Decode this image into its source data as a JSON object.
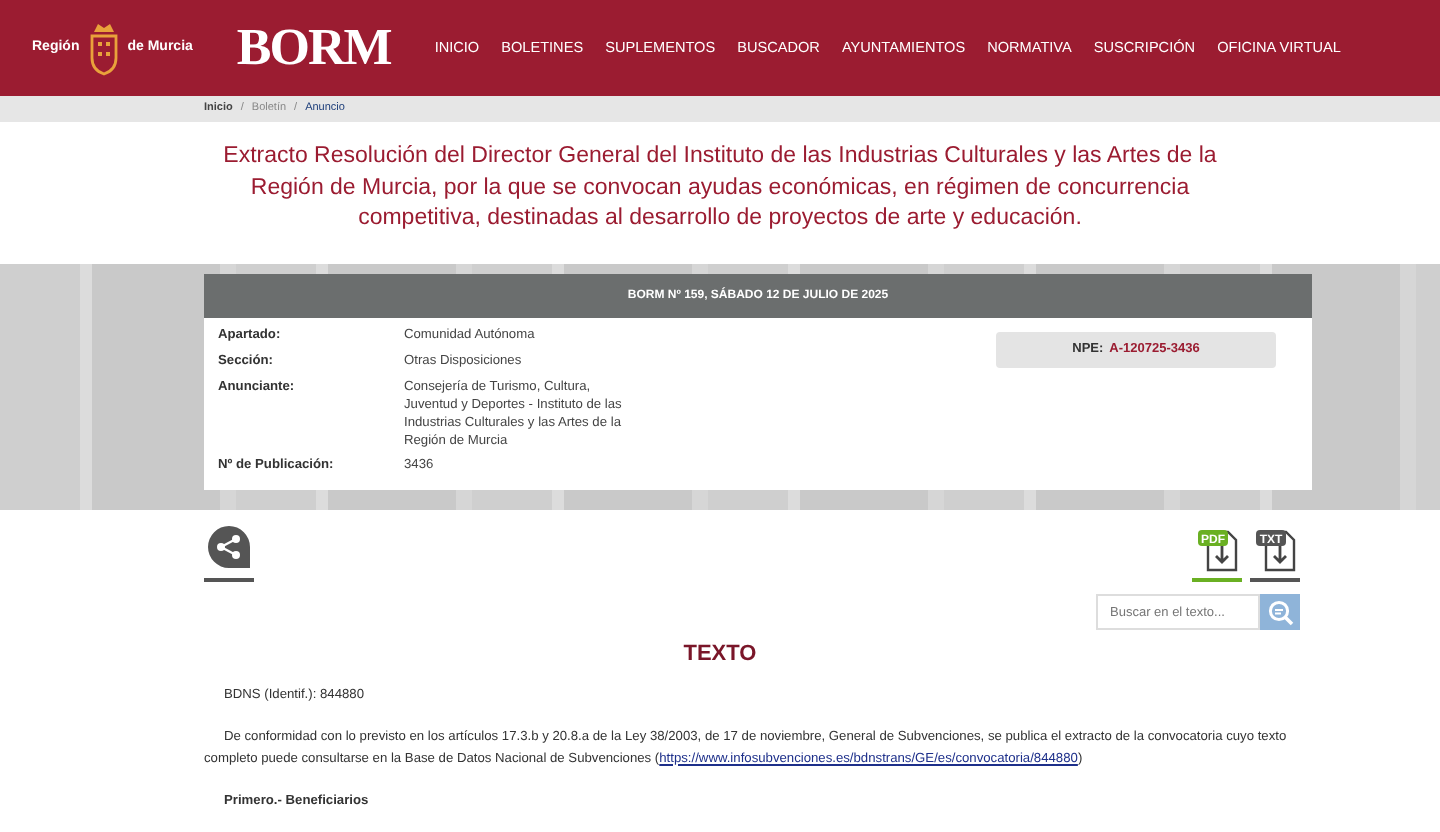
{
  "header": {
    "region_logo": {
      "left": "Región",
      "right": "de Murcia"
    },
    "site_logo": "BORM",
    "nav": [
      "INICIO",
      "BOLETINES",
      "SUPLEMENTOS",
      "BUSCADOR",
      "AYUNTAMIENTOS",
      "NORMATIVA",
      "SUSCRIPCIÓN",
      "OFICINA VIRTUAL"
    ]
  },
  "breadcrumb": [
    {
      "label": "Inicio",
      "kind": "link"
    },
    {
      "label": "Boletín",
      "kind": "muted"
    },
    {
      "label": "Anuncio",
      "kind": "current"
    }
  ],
  "breadcrumb_separator": "/",
  "title": "Extracto Resolución del Director General del Instituto de las Industrias Culturales y las Artes de la Región de Murcia, por la que se convocan ayudas económicas, en régimen de concurrencia competitiva, destinadas al desarrollo de proyectos de arte y educación.",
  "bulletin": {
    "heading": "BORM Nº 159, SÁBADO 12 DE JULIO DE 2025",
    "fields": [
      {
        "label": "Apartado:",
        "value": "Comunidad Autónoma"
      },
      {
        "label": "Sección:",
        "value": "Otras Disposiciones"
      },
      {
        "label": "Anunciante:",
        "value": "Consejería de Turismo, Cultura, Juventud y Deportes - Instituto de las Industrias Culturales y las Artes de la Región de Murcia"
      },
      {
        "label": "Nº de Publicación:",
        "value": "3436"
      }
    ],
    "npe": {
      "label": "NPE:",
      "value": "A-120725-3436"
    }
  },
  "downloads": [
    {
      "label": "PDF",
      "color": "#6ab023"
    },
    {
      "label": "TXT",
      "color": "#555555"
    }
  ],
  "search": {
    "placeholder": "Buscar en el texto..."
  },
  "text_heading": "TEXTO",
  "body": [
    {
      "kind": "plain",
      "text": "BDNS (Identif.): 844880"
    },
    {
      "kind": "link_paragraph",
      "text": "De conformidad con lo previsto en los artículos 17.3.b y 20.8.a de la Ley 38/2003, de 17 de noviembre, General de Subvenciones, se publica el extracto de la convocatoria cuyo texto completo puede consultarse en la Base de Datos Nacional de Subvenciones (",
      "link": "https://www.infosubvenciones.es/bdnstrans/GE/es/convocatoria/844880",
      "after": ")"
    },
    {
      "kind": "bold",
      "text": "Primero.- Beneficiarios"
    }
  ]
}
